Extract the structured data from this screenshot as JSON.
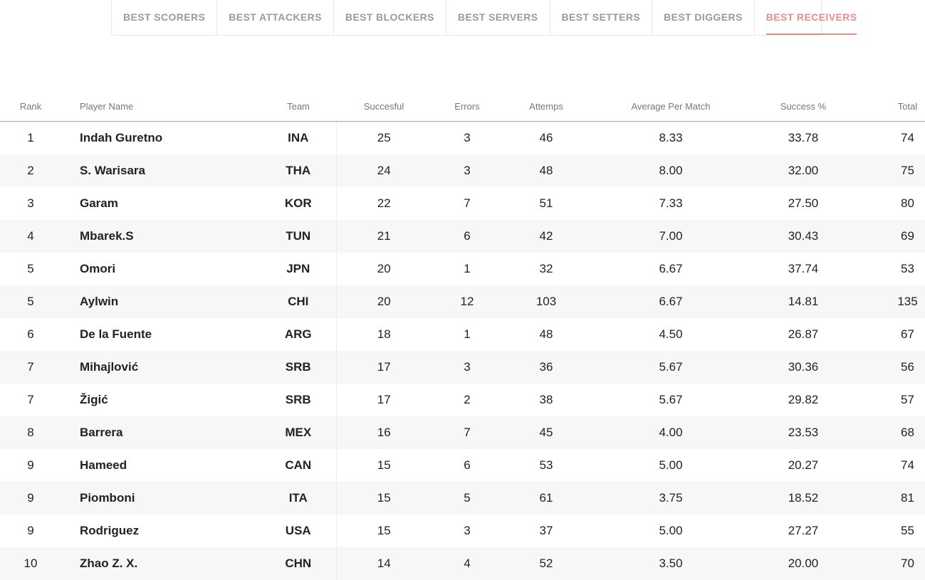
{
  "tabs": [
    {
      "label": "BEST SCORERS",
      "active": false
    },
    {
      "label": "BEST ATTACKERS",
      "active": false
    },
    {
      "label": "BEST BLOCKERS",
      "active": false
    },
    {
      "label": "BEST SERVERS",
      "active": false
    },
    {
      "label": "BEST SETTERS",
      "active": false
    },
    {
      "label": "BEST DIGGERS",
      "active": false
    },
    {
      "label": "BEST RECEIVERS",
      "active": true
    }
  ],
  "colors": {
    "accent": "#ec8b8c",
    "tab_inactive": "#9a9a9a",
    "row_alt": "#f7f7f7"
  },
  "table": {
    "headers": {
      "rank": "Rank",
      "player": "Player Name",
      "team": "Team",
      "successful": "Succesful",
      "errors": "Errors",
      "attempts": "Attemps",
      "average": "Average Per Match",
      "success_pct": "Success %",
      "total": "Total"
    },
    "rows": [
      {
        "rank": "1",
        "player": "Indah Guretno",
        "team": "INA",
        "successful": "25",
        "errors": "3",
        "attempts": "46",
        "average": "8.33",
        "success_pct": "33.78",
        "total": "74"
      },
      {
        "rank": "2",
        "player": "S. Warisara",
        "team": "THA",
        "successful": "24",
        "errors": "3",
        "attempts": "48",
        "average": "8.00",
        "success_pct": "32.00",
        "total": "75"
      },
      {
        "rank": "3",
        "player": "Garam",
        "team": "KOR",
        "successful": "22",
        "errors": "7",
        "attempts": "51",
        "average": "7.33",
        "success_pct": "27.50",
        "total": "80"
      },
      {
        "rank": "4",
        "player": "Mbarek.S",
        "team": "TUN",
        "successful": "21",
        "errors": "6",
        "attempts": "42",
        "average": "7.00",
        "success_pct": "30.43",
        "total": "69"
      },
      {
        "rank": "5",
        "player": "Omori",
        "team": "JPN",
        "successful": "20",
        "errors": "1",
        "attempts": "32",
        "average": "6.67",
        "success_pct": "37.74",
        "total": "53"
      },
      {
        "rank": "5",
        "player": "Aylwin",
        "team": "CHI",
        "successful": "20",
        "errors": "12",
        "attempts": "103",
        "average": "6.67",
        "success_pct": "14.81",
        "total": "135"
      },
      {
        "rank": "6",
        "player": "De la Fuente",
        "team": "ARG",
        "successful": "18",
        "errors": "1",
        "attempts": "48",
        "average": "4.50",
        "success_pct": "26.87",
        "total": "67"
      },
      {
        "rank": "7",
        "player": "Mihajlović",
        "team": "SRB",
        "successful": "17",
        "errors": "3",
        "attempts": "36",
        "average": "5.67",
        "success_pct": "30.36",
        "total": "56"
      },
      {
        "rank": "7",
        "player": "Žigić",
        "team": "SRB",
        "successful": "17",
        "errors": "2",
        "attempts": "38",
        "average": "5.67",
        "success_pct": "29.82",
        "total": "57"
      },
      {
        "rank": "8",
        "player": "Barrera",
        "team": "MEX",
        "successful": "16",
        "errors": "7",
        "attempts": "45",
        "average": "4.00",
        "success_pct": "23.53",
        "total": "68"
      },
      {
        "rank": "9",
        "player": "Hameed",
        "team": "CAN",
        "successful": "15",
        "errors": "6",
        "attempts": "53",
        "average": "5.00",
        "success_pct": "20.27",
        "total": "74"
      },
      {
        "rank": "9",
        "player": "Piomboni",
        "team": "ITA",
        "successful": "15",
        "errors": "5",
        "attempts": "61",
        "average": "3.75",
        "success_pct": "18.52",
        "total": "81"
      },
      {
        "rank": "9",
        "player": "Rodriguez",
        "team": "USA",
        "successful": "15",
        "errors": "3",
        "attempts": "37",
        "average": "5.00",
        "success_pct": "27.27",
        "total": "55"
      },
      {
        "rank": "10",
        "player": "Zhao Z. X.",
        "team": "CHN",
        "successful": "14",
        "errors": "4",
        "attempts": "52",
        "average": "3.50",
        "success_pct": "20.00",
        "total": "70"
      }
    ]
  }
}
